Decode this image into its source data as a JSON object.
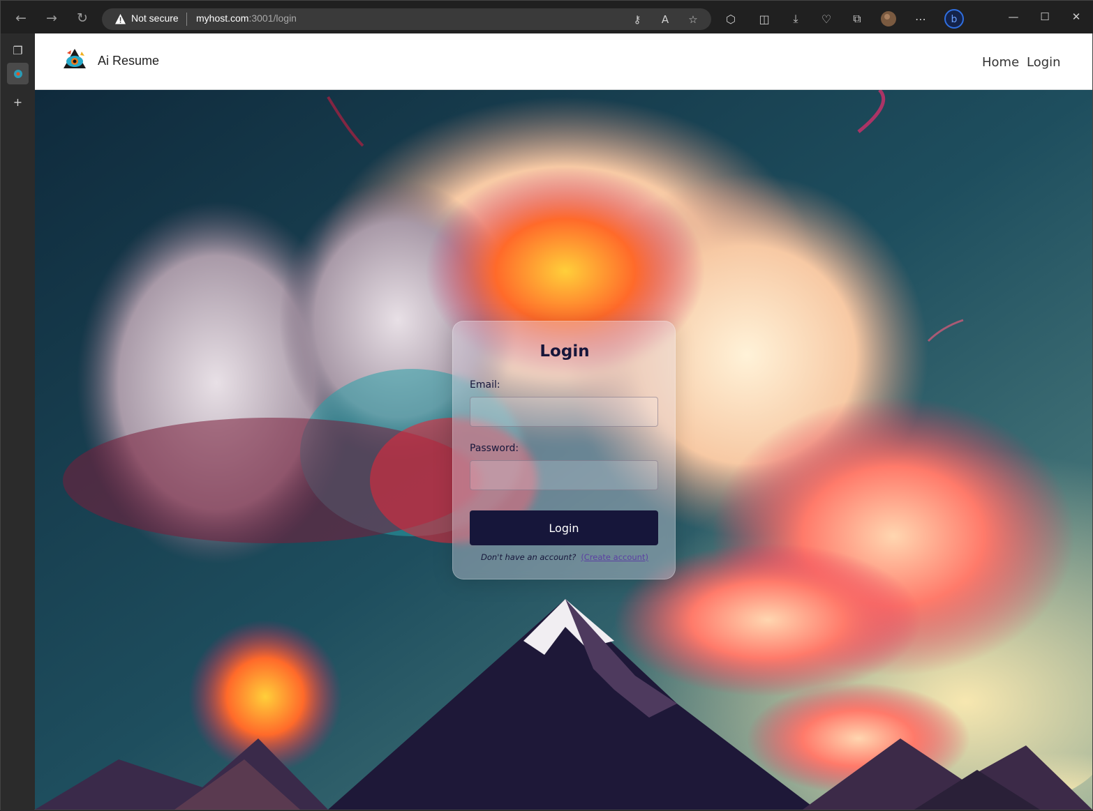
{
  "browser": {
    "address": {
      "security_label": "Not secure",
      "url_host": "myhost.com",
      "url_path": ":3001/login"
    },
    "icons": {
      "back": "back-arrow-icon",
      "forward": "forward-arrow-icon",
      "refresh": "refresh-icon"
    }
  },
  "site": {
    "brand": "Ai Resume",
    "nav": [
      "Home",
      "Login"
    ]
  },
  "login_card": {
    "title": "Login",
    "email_label": "Email:",
    "email_value": "",
    "password_label": "Password:",
    "password_value": "",
    "submit_label": "Login",
    "footer_question": "Don't have an account?",
    "footer_link": "(Create account)"
  },
  "colors": {
    "primary": "#16163a",
    "link": "#5b3fa3"
  }
}
